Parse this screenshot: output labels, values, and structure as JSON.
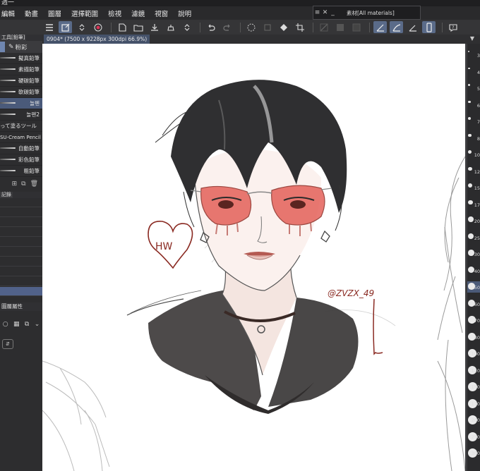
{
  "app": {
    "title": "週一"
  },
  "menu": [
    "編輯",
    "動畫",
    "圖層",
    "選擇範圍",
    "檢視",
    "濾鏡",
    "視窗",
    "說明"
  ],
  "material_palette": {
    "title": "素材[All materials]",
    "controls": [
      "≡",
      "✕",
      "_"
    ]
  },
  "document_tab": {
    "label": "0904* (7500 x 9228px 300dpi 66.9%)"
  },
  "subtool_panel": {
    "tab_label": "工具[鉛筆]",
    "group_label": "粉彩",
    "brushes": [
      {
        "label": "擬真鉛筆"
      },
      {
        "label": "素描鉛筆"
      },
      {
        "label": "硬碳鉛筆"
      },
      {
        "label": "軟碳鉛筆"
      },
      {
        "label": "놀펜"
      },
      {
        "label": "놀펜2"
      },
      {
        "label": "って塗るツール"
      },
      {
        "label": "SU-Cream Pencil"
      },
      {
        "label": "自動鉛筆"
      },
      {
        "label": "彩色鉛筆"
      },
      {
        "label": "粗鉛筆"
      }
    ]
  },
  "history_panel": {
    "tab_label": "記錄",
    "rows": [
      "",
      "",
      "",
      "",
      "",
      "",
      "",
      "",
      "",
      ""
    ]
  },
  "layer_property": {
    "tab_label": "圖層屬性"
  },
  "canvas": {
    "signature": "@ZVZX_49"
  },
  "brush_sizes": [
    "3",
    "4",
    "5",
    "6",
    "7",
    "8",
    "10",
    "12",
    "15",
    "17",
    "20",
    "25",
    "30",
    "40",
    "50",
    "60",
    "70",
    "80",
    "100",
    "120",
    "150",
    "170",
    "200",
    "250",
    "300"
  ],
  "colors": {
    "selected": "#4b5a78",
    "lens": "#e4615a",
    "ink": "#2b2b2b",
    "accent_red": "#8a2a22"
  }
}
